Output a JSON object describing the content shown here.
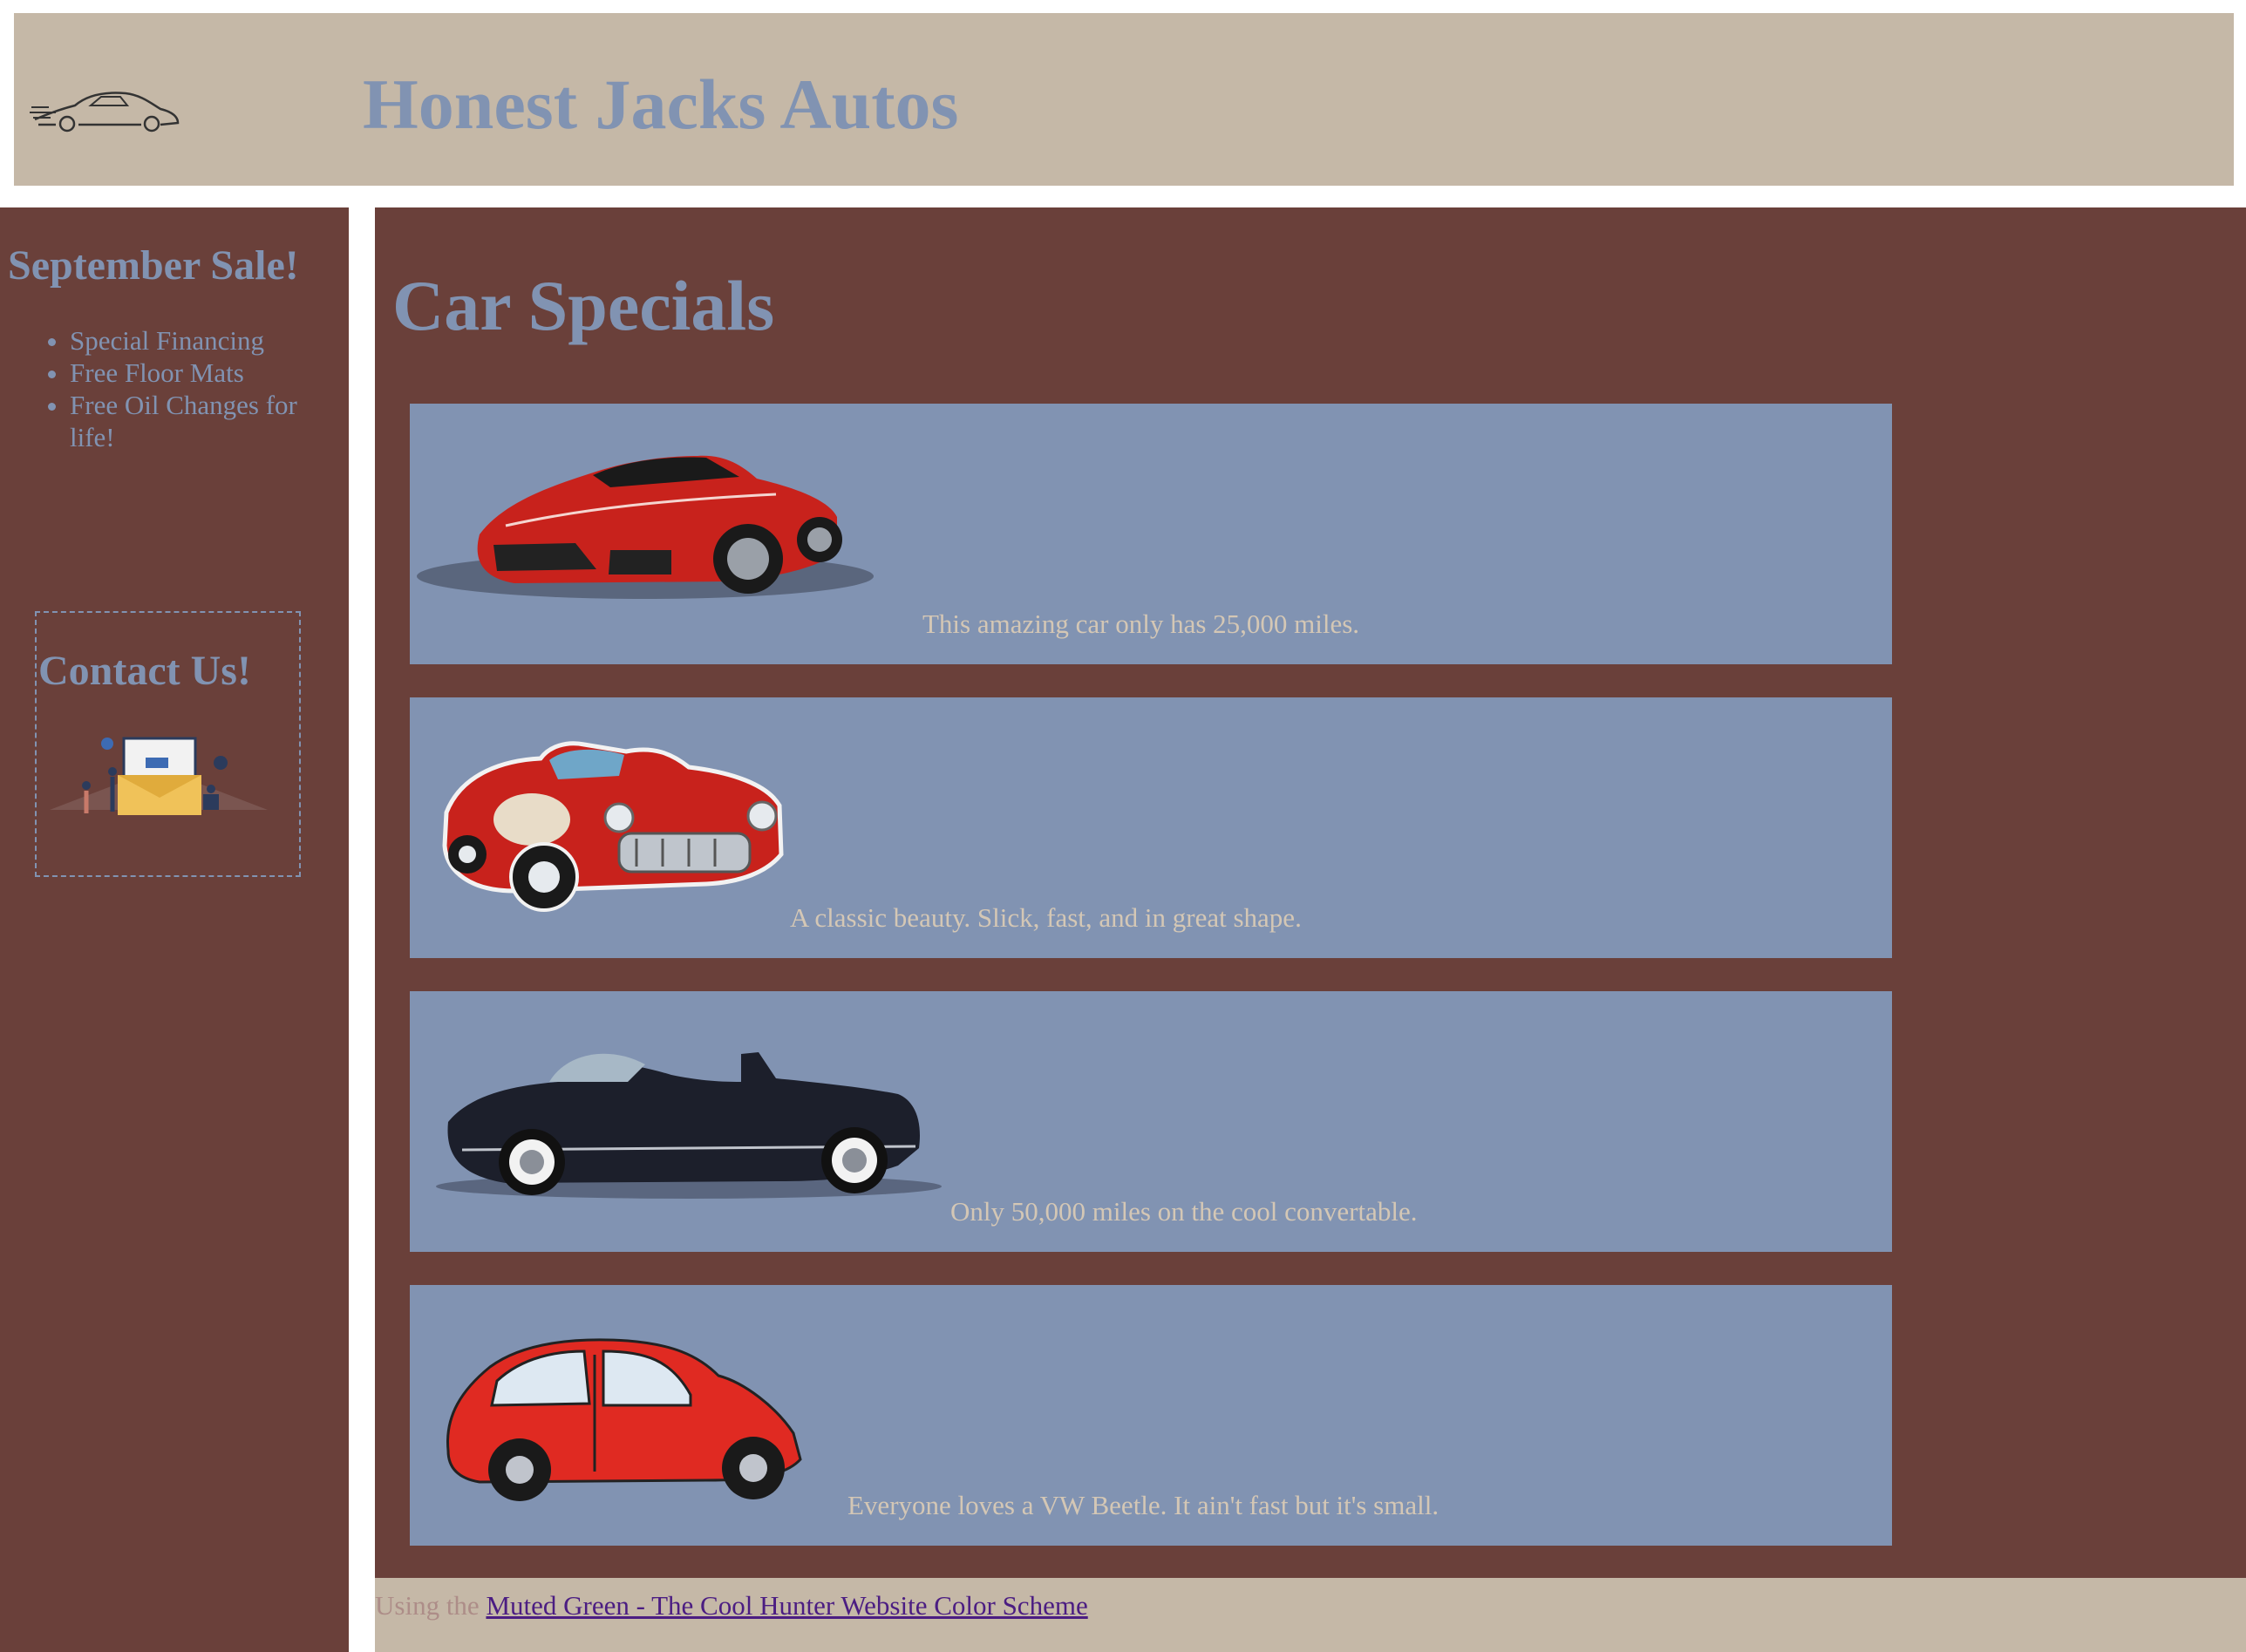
{
  "header": {
    "logo_icon": "sports-car-logo",
    "title": "Honest Jacks Autos"
  },
  "sidebar": {
    "sale_title": "September Sale!",
    "sale_items": [
      "Special Financing",
      "Free Floor Mats",
      "Free Oil Changes for life!"
    ],
    "contact_title": "Contact Us!",
    "contact_icon": "contact-support-illustration"
  },
  "main": {
    "title": "Car Specials",
    "cards": [
      {
        "image": "red-sports-car",
        "caption": "This amazing car only has 25,000 miles."
      },
      {
        "image": "red-classic-convertible",
        "caption": "A classic beauty. Slick, fast, and in great shape."
      },
      {
        "image": "black-vintage-convertible",
        "caption": "Only 50,000 miles on the cool convertable."
      },
      {
        "image": "red-vw-beetle",
        "caption": "Everyone loves a VW Beetle. It ain't fast but it's small."
      }
    ]
  },
  "footer": {
    "prefix": "Using the ",
    "link_text": "Muted Green - The Cool Hunter Website Color Scheme"
  },
  "colors": {
    "header_bg": "#c5b8a7",
    "panel_bg": "#6a403a",
    "accent_blue": "#8193b2",
    "caption_text": "#d4c7b5",
    "link": "#4b1d82"
  }
}
